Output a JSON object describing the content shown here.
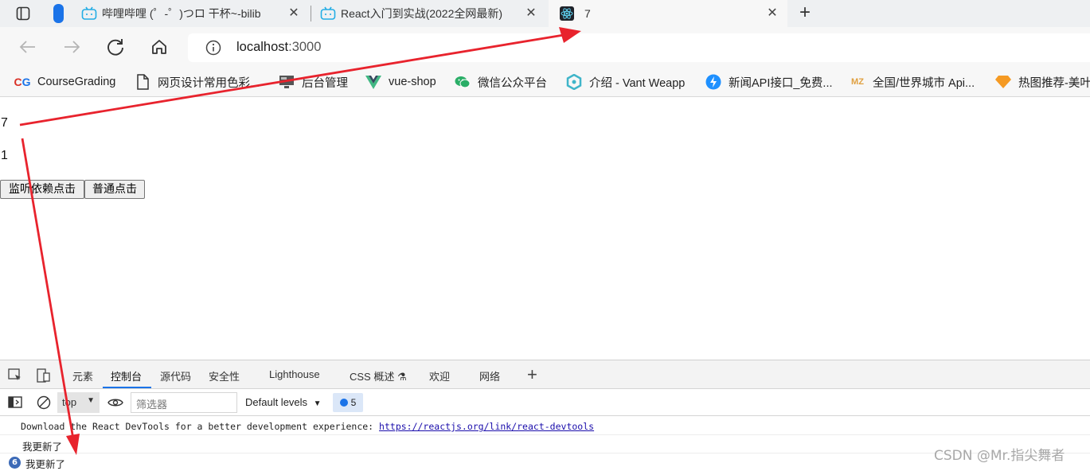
{
  "tabs": [
    {
      "title": "哔哩哔哩 (゜-゜)つロ 干杯~-bilib",
      "icon": "bilibili-icon"
    },
    {
      "title": "React入门到实战(2022全网最新)",
      "icon": "bilibili-icon"
    },
    {
      "title": "7",
      "icon": "react-icon"
    }
  ],
  "new_tab_label": "+",
  "address": {
    "host": "localhost",
    "port": ":3000"
  },
  "bookmarks": [
    {
      "label": "CourseGrading",
      "icon": "coursegrading-icon"
    },
    {
      "label": "网页设计常用色彩...",
      "icon": "document-icon"
    },
    {
      "label": "后台管理",
      "icon": "monitor-icon"
    },
    {
      "label": "vue-shop",
      "icon": "vue-icon"
    },
    {
      "label": "微信公众平台",
      "icon": "wechat-icon"
    },
    {
      "label": "介绍 - Vant Weapp",
      "icon": "vant-icon"
    },
    {
      "label": "新闻API接口_免费...",
      "icon": "lightning-icon"
    },
    {
      "label": "全国/世界城市 Api...",
      "icon": "mz-icon"
    },
    {
      "label": "热图推荐-美叶",
      "icon": "diamond-icon"
    }
  ],
  "page": {
    "count_a": "7",
    "count_b": "1",
    "btn_effect": "监听依赖点击",
    "btn_normal": "普通点击"
  },
  "devtools": {
    "tabs": [
      "元素",
      "控制台",
      "源代码",
      "安全性",
      "Lighthouse",
      "CSS 概述",
      "欢迎",
      "网络"
    ],
    "active_tab": "控制台",
    "context": "top",
    "filter_placeholder": "筛选器",
    "levels": "Default levels",
    "message_count": "5",
    "logs": {
      "devtools_msg": "Download the React DevTools for a better development experience: ",
      "devtools_link": "https://reactjs.org/link/react-devtools",
      "update_1": "我更新了",
      "update_repeat_count": "6",
      "update_2": "我更新了"
    }
  },
  "watermark": "CSDN @Mr.指尖舞者",
  "colors": {
    "arrow": "#e8232d",
    "accent": "#1a73e8"
  }
}
